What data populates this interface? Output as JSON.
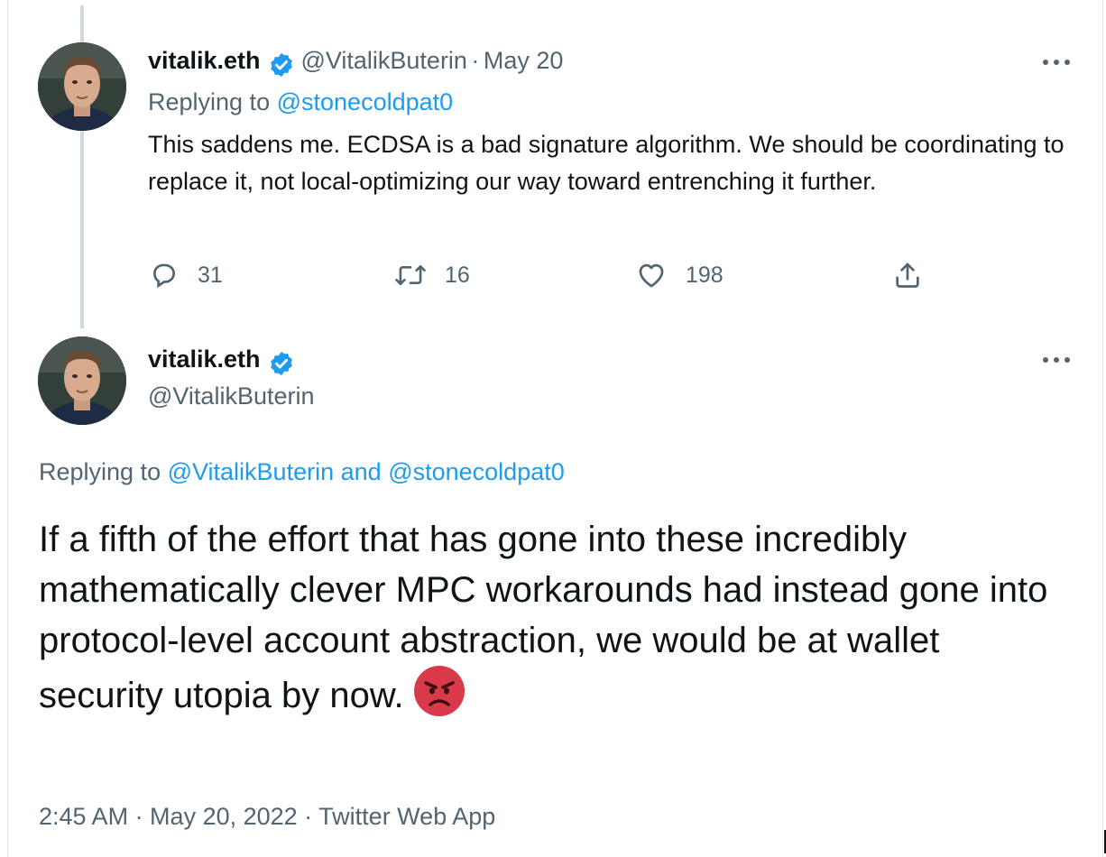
{
  "tweet1": {
    "name": "vitalik.eth",
    "handle": "@VitalikButerin",
    "separator": "·",
    "date": "May 20",
    "replying_prefix": "Replying to",
    "replying_to": "@stonecoldpat0",
    "body": "This saddens me. ECDSA is a bad signature algorithm. We should be coordinating to replace it, not local-optimizing our way toward entrenching it further.",
    "actions": {
      "reply_count": "31",
      "retweet_count": "16",
      "like_count": "198"
    }
  },
  "tweet2": {
    "name": "vitalik.eth",
    "handle": "@VitalikButerin",
    "replying_prefix": "Replying to",
    "replying_to_1": "@VitalikButerin",
    "replying_and": "and",
    "replying_to_2": "@stonecoldpat0",
    "body": "If a fifth of the effort that has gone into these incredibly mathematically clever MPC workarounds had instead gone into protocol-level account abstraction, we would be at wallet security utopia by now.",
    "timestamp": "2:45 AM · May 20, 2022 · Twitter Web App"
  },
  "icons": {
    "verified": "verified-badge-icon",
    "more": "more-options-icon",
    "reply": "reply-bubble-icon",
    "retweet": "retweet-icon",
    "like": "heart-icon",
    "share": "share-upload-icon",
    "emoji": "angry-face-emoji"
  },
  "colors": {
    "link": "#1d9bf0",
    "muted": "#536471",
    "text": "#0f1419",
    "thread_line": "#cfd9de",
    "emoji": "#d83a4a"
  }
}
